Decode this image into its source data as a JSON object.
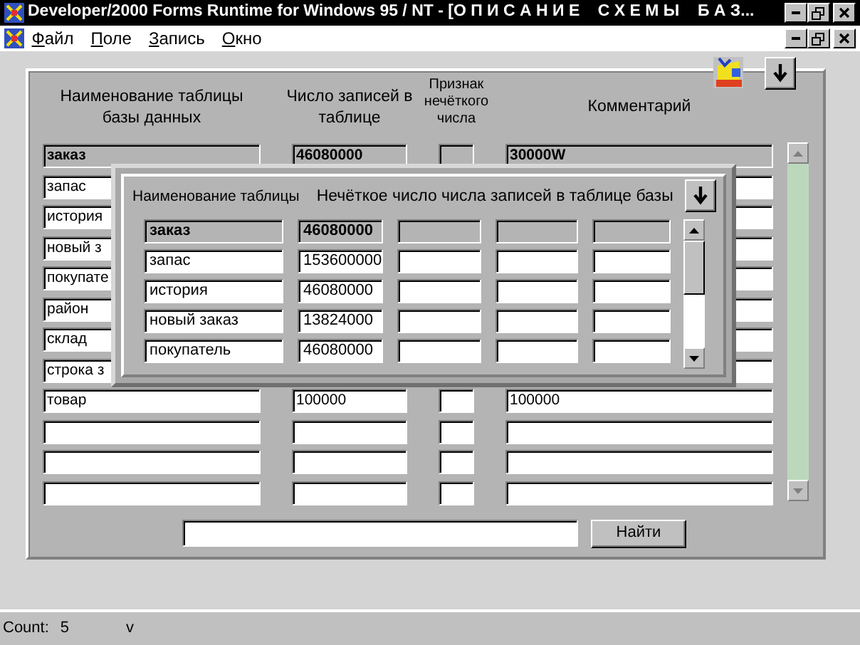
{
  "window": {
    "title": "Developer/2000 Forms Runtime for Windows 95 / NT - [О П И С А Н И Е    С Х Е М Ы    Б А З..."
  },
  "menu": [
    "Файл",
    "Поле",
    "Запись",
    "Окно"
  ],
  "form": {
    "columns": [
      "Наименование таблицы базы данных",
      "Число записей в таблице",
      "Признак нечёткого числа",
      "Комментарий"
    ],
    "rows": [
      {
        "name": "заказ",
        "count": "46080000",
        "flag": "",
        "comment": "30000W",
        "current": true
      },
      {
        "name": "запас",
        "count": "",
        "flag": "",
        "comment": "",
        "current": false
      },
      {
        "name": "история",
        "count": "",
        "flag": "",
        "comment": "",
        "current": false
      },
      {
        "name": "новый з",
        "count": "",
        "flag": "",
        "comment": "",
        "current": false
      },
      {
        "name": "покупате",
        "count": "",
        "flag": "",
        "comment": "",
        "current": false
      },
      {
        "name": "район",
        "count": "",
        "flag": "",
        "comment": "",
        "current": false
      },
      {
        "name": "склад",
        "count": "",
        "flag": "",
        "comment": "",
        "current": false
      },
      {
        "name": "строка з",
        "count": "",
        "flag": "",
        "comment": "",
        "current": false
      },
      {
        "name": "товар",
        "count": "100000",
        "flag": "",
        "comment": "100000",
        "current": false
      },
      {
        "name": "",
        "count": "",
        "flag": "",
        "comment": "",
        "current": false
      },
      {
        "name": "",
        "count": "",
        "flag": "",
        "comment": "",
        "current": false
      },
      {
        "name": "",
        "count": "",
        "flag": "",
        "comment": "",
        "current": false
      }
    ],
    "search_button": "Найти"
  },
  "dialog": {
    "columns": [
      "Наименование таблицы",
      "Нечёткое число числа записей в таблице базы"
    ],
    "rows": [
      {
        "name": "заказ",
        "count": "46080000",
        "current": true
      },
      {
        "name": "запас",
        "count": "153600000",
        "current": false
      },
      {
        "name": "история",
        "count": "46080000",
        "current": false
      },
      {
        "name": "новый заказ",
        "count": "13824000",
        "current": false
      },
      {
        "name": "покупатель",
        "count": "46080000",
        "current": false
      }
    ]
  },
  "status_bar": {
    "label": "Count:",
    "count": "5",
    "mode": "v"
  }
}
